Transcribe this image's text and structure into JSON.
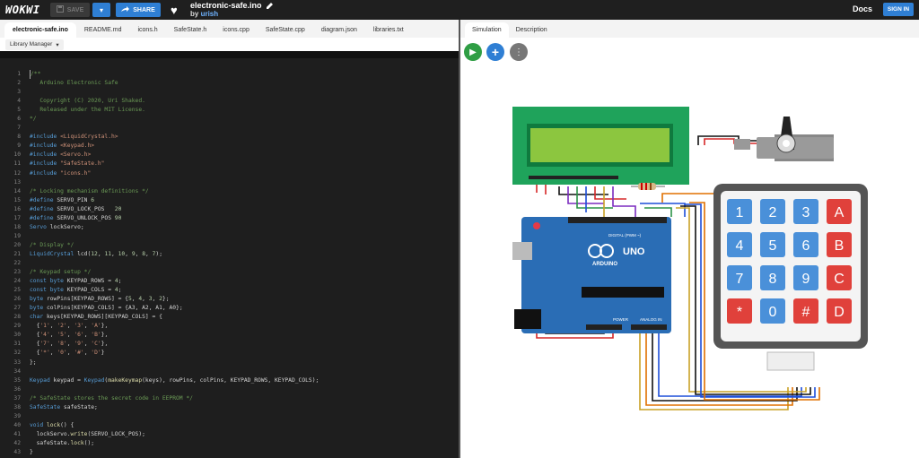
{
  "header": {
    "logo": "WOKWI",
    "save_label": "SAVE",
    "share_label": "SHARE",
    "project_title": "electronic-safe.ino",
    "by_label": "by",
    "author": "urish",
    "docs_label": "Docs",
    "signin_label": "SIGN IN"
  },
  "editor": {
    "tabs": [
      "electronic-safe.ino",
      "README.md",
      "icons.h",
      "SafeState.h",
      "icons.cpp",
      "SafeState.cpp",
      "diagram.json",
      "libraries.txt"
    ],
    "library_manager_label": "Library Manager",
    "lines": [
      "/**",
      "   Arduino Electronic Safe",
      "",
      "   Copyright (C) 2020, Uri Shaked.",
      "   Released under the MIT License.",
      "*/",
      "",
      "#include <LiquidCrystal.h>",
      "#include <Keypad.h>",
      "#include <Servo.h>",
      "#include \"SafeState.h\"",
      "#include \"icons.h\"",
      "",
      "/* Locking mechanism definitions */",
      "#define SERVO_PIN 6",
      "#define SERVO_LOCK_POS   20",
      "#define SERVO_UNLOCK_POS 90",
      "Servo lockServo;",
      "",
      "/* Display */",
      "LiquidCrystal lcd(12, 11, 10, 9, 8, 7);",
      "",
      "/* Keypad setup */",
      "const byte KEYPAD_ROWS = 4;",
      "const byte KEYPAD_COLS = 4;",
      "byte rowPins[KEYPAD_ROWS] = {5, 4, 3, 2};",
      "byte colPins[KEYPAD_COLS] = {A3, A2, A1, A0};",
      "char keys[KEYPAD_ROWS][KEYPAD_COLS] = {",
      "  {'1', '2', '3', 'A'},",
      "  {'4', '5', '6', 'B'},",
      "  {'7', '8', '9', 'C'},",
      "  {'*', '0', '#', 'D'}",
      "};",
      "",
      "Keypad keypad = Keypad(makeKeymap(keys), rowPins, colPins, KEYPAD_ROWS, KEYPAD_COLS);",
      "",
      "/* SafeState stores the secret code in EEPROM */",
      "SafeState safeState;",
      "",
      "void lock() {",
      "  lockServo.write(SERVO_LOCK_POS);",
      "  safeState.lock();",
      "}"
    ]
  },
  "simulation": {
    "tabs": [
      "Simulation",
      "Description"
    ],
    "play_icon": "play-icon",
    "add_icon": "plus-icon",
    "more_icon": "more-vertical-icon",
    "arduino_brand": "ARDUINO",
    "arduino_model": "UNO",
    "arduino_digital_label": "DIGITAL (PWM ~)",
    "arduino_power_label": "POWER",
    "arduino_analog_label": "ANALOG IN",
    "keypad_keys": [
      "1",
      "2",
      "3",
      "A",
      "4",
      "5",
      "6",
      "B",
      "7",
      "8",
      "9",
      "C",
      "*",
      "0",
      "#",
      "D"
    ],
    "colors": {
      "accent": "#2f7fd4",
      "lcd_board": "#1fa35b",
      "lcd_screen": "#8cc63f",
      "arduino_board": "#2a6db5",
      "key_blue": "#4a90d9",
      "key_red": "#e0413b"
    }
  }
}
